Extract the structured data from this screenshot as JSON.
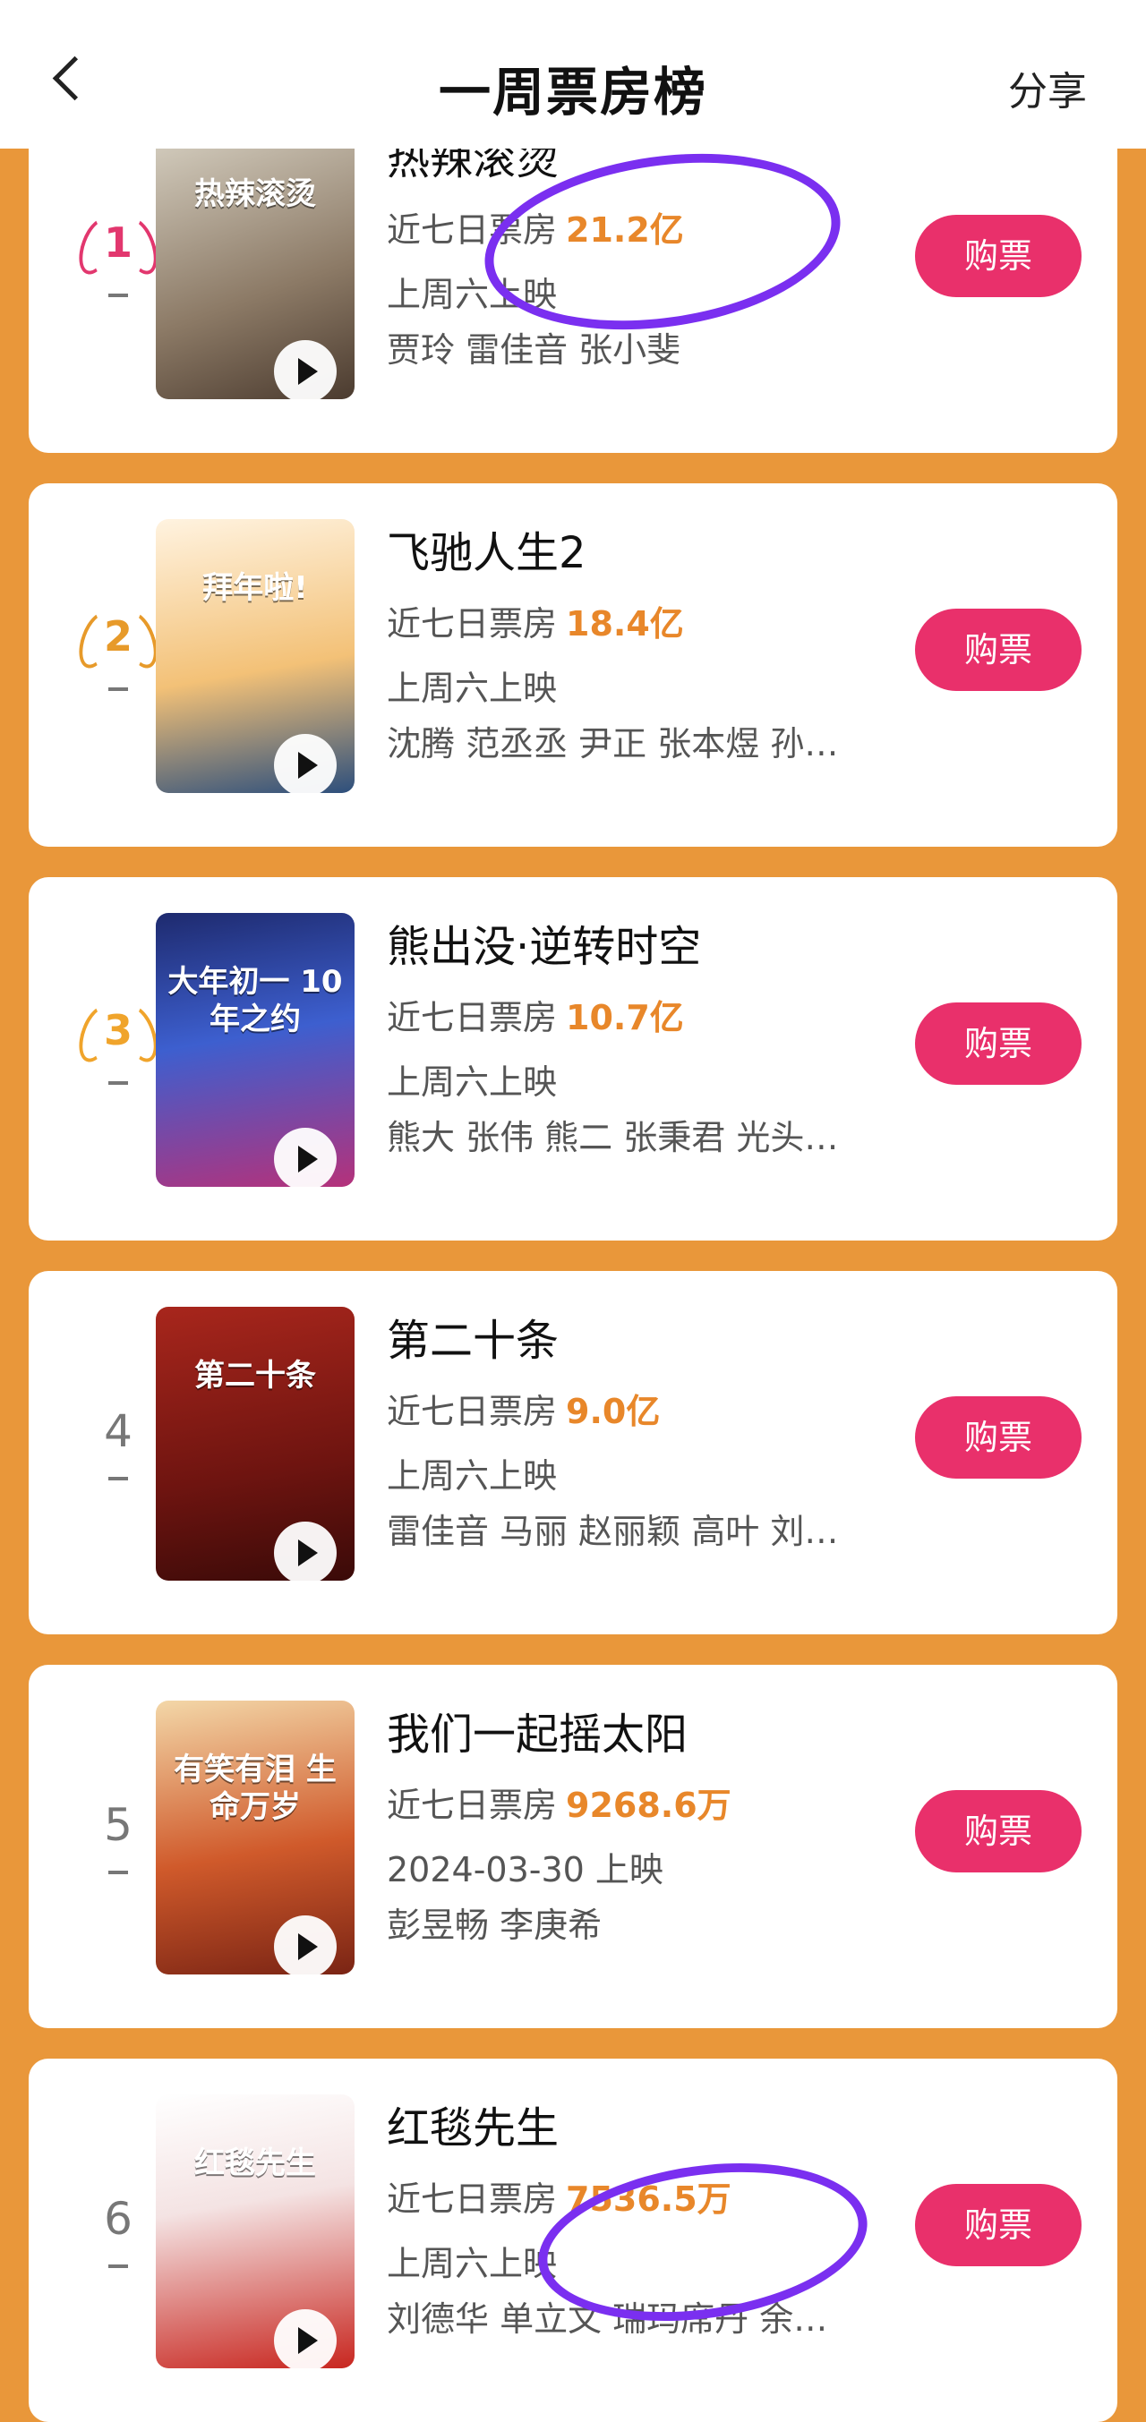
{
  "header": {
    "title": "一周票房榜",
    "share_label": "分享"
  },
  "movies": [
    {
      "rank": "1",
      "name": "热辣滚烫",
      "boxoffice_label": "近七日票房",
      "boxoffice": "21.2亿",
      "release": "上周六上映",
      "cast": "贾玲 雷佳音 张小斐",
      "buy_label": "购票",
      "poster_text": "热辣滚烫",
      "medal_color": "#e2376e",
      "poster_bg": "linear-gradient(160deg,#d8d2c4,#8c7a66 60%,#4b3b2f)"
    },
    {
      "rank": "2",
      "name": "飞驰人生2",
      "boxoffice_label": "近七日票房",
      "boxoffice": "18.4亿",
      "release": "上周六上映",
      "cast": "沈腾 范丞丞 尹正 张本煜 孙…",
      "buy_label": "购票",
      "poster_text": "拜年啦!",
      "medal_color": "#e79a2a",
      "poster_bg": "linear-gradient(170deg,#fff3e0,#f3c177 55%,#2d4f7c)"
    },
    {
      "rank": "3",
      "name": "熊出没·逆转时空",
      "boxoffice_label": "近七日票房",
      "boxoffice": "10.7亿",
      "release": "上周六上映",
      "cast": "熊大 张伟 熊二 张秉君 光头…",
      "buy_label": "购票",
      "poster_text": "大年初一 10年之约",
      "medal_color": "#f0a42b",
      "poster_bg": "linear-gradient(170deg,#1e2a6e,#3d5fcf 45%,#b5317a)"
    },
    {
      "rank": "4",
      "name": "第二十条",
      "boxoffice_label": "近七日票房",
      "boxoffice": "9.0亿",
      "release": "上周六上映",
      "cast": "雷佳音 马丽 赵丽颖 高叶 刘…",
      "buy_label": "购票",
      "poster_text": "第二十条",
      "medal_color": "",
      "poster_bg": "linear-gradient(170deg,#a8261c,#6e1410 60%,#3a0a08)"
    },
    {
      "rank": "5",
      "name": "我们一起摇太阳",
      "boxoffice_label": "近七日票房",
      "boxoffice": "9268.6万",
      "release": "2024-03-30 上映",
      "cast": "彭昱畅 李庚希",
      "buy_label": "购票",
      "poster_text": "有笑有泪 生命万岁",
      "medal_color": "",
      "poster_bg": "linear-gradient(170deg,#f3d7a8,#d05a2b 55%,#7a2414)"
    },
    {
      "rank": "6",
      "name": "红毯先生",
      "boxoffice_label": "近七日票房",
      "boxoffice": "7536.5万",
      "release": "上周六上映",
      "cast": "刘德华 单立文 瑞玛席丹 余…",
      "buy_label": "购票",
      "poster_text": "红毯先生",
      "medal_color": "",
      "poster_bg": "linear-gradient(170deg,#ffffff,#f4e3e3 40%,#c8261f)"
    }
  ]
}
